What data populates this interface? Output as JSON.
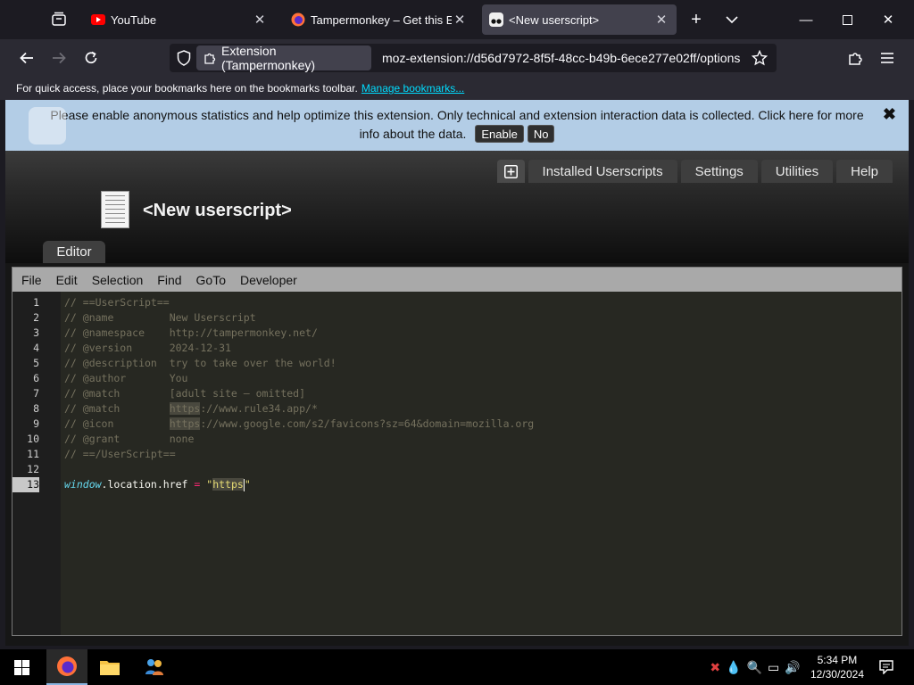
{
  "browser": {
    "tabs": [
      {
        "title": "YouTube",
        "icon": "youtube-icon"
      },
      {
        "title": "Tampermonkey – Get this Exter",
        "icon": "firefox-addons-icon"
      },
      {
        "title": "<New userscript>",
        "icon": "tampermonkey-icon",
        "active": true
      }
    ],
    "identity": "Extension (Tampermonkey)",
    "url": "moz-extension://d56d7972-8f5f-48cc-b49b-6ece277e02ff/options",
    "bookmarks_msg": "For quick access, place your bookmarks here on the bookmarks toolbar.",
    "bookmarks_link": "Manage bookmarks..."
  },
  "banner": {
    "message": "Please enable anonymous statistics and help optimize this extension. Only technical and extension interaction data is collected. Click here for more info about the data.",
    "enable": "Enable",
    "no": "No",
    "close": "✖"
  },
  "header": {
    "tabs": [
      "Installed Userscripts",
      "Settings",
      "Utilities",
      "Help"
    ],
    "script_title": "<New userscript>",
    "editor_tab": "Editor"
  },
  "editor": {
    "menu": [
      "File",
      "Edit",
      "Selection",
      "Find",
      "GoTo",
      "Developer"
    ],
    "current_line": 13,
    "lines": [
      "// ==UserScript==",
      "// @name         New Userscript",
      "// @namespace    http://tampermonkey.net/",
      "// @version      2024-12-31",
      "// @description  try to take over the world!",
      "// @author       You",
      "// @match        [adult site — omitted]",
      "// @match        https://www.rule34.app/*",
      "// @icon         https://www.google.com/s2/favicons?sz=64&domain=mozilla.org",
      "// @grant        none",
      "// ==/UserScript==",
      "",
      "window.location.href = \"https\""
    ]
  },
  "taskbar": {
    "time": "5:34 PM",
    "date": "12/30/2024"
  },
  "colors": {
    "banner_bg": "#b3cde6",
    "url_link": "#00ddff",
    "editor_bg": "#272822"
  }
}
